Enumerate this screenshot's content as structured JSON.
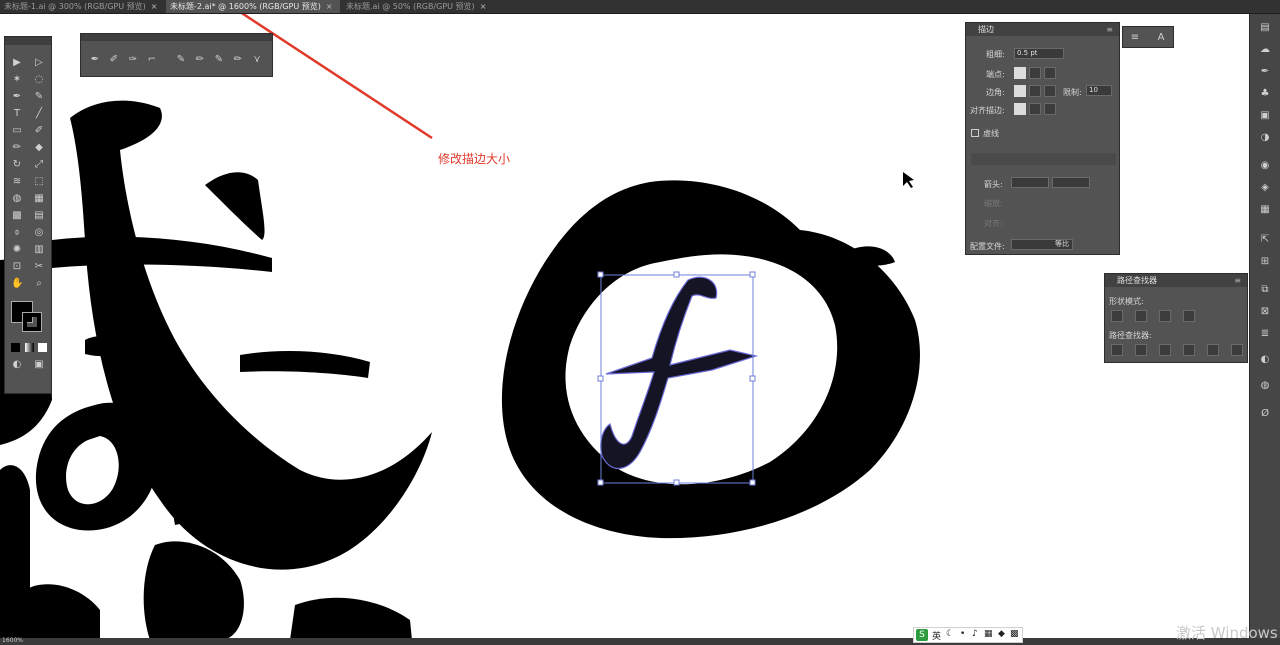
{
  "tabs": [
    {
      "label": "未标题-1.ai @ 300% (RGB/GPU 预览)",
      "close": "×"
    },
    {
      "label": "未标题-2.ai* @ 1600% (RGB/GPU 预览)",
      "close": "×"
    },
    {
      "label": "未标题.ai @ 50% (RGB/GPU 预览)",
      "close": "×"
    }
  ],
  "annotation": {
    "text": "修改描边大小",
    "color": "#e03a2a"
  },
  "stroke_panel": {
    "title": "描边",
    "weight_label": "粗细:",
    "weight_value": "0.5 pt",
    "cap_label": "端点:",
    "corner_label": "边角:",
    "limit_label": "限制:",
    "limit_value": "10",
    "align_label": "对齐描边:",
    "dashed_label": "虚线",
    "arrow_label": "箭头:",
    "scale_label": "缩放:",
    "align2_label": "对齐:",
    "profile_label": "配置文件:",
    "profile_value": "等比"
  },
  "pathfinder_panel": {
    "title": "路径查找器",
    "shape_modes_label": "形状模式:",
    "pathfinders_label": "路径查找器:"
  },
  "status": {
    "zoom": "1600%"
  },
  "ime": {
    "label": "英"
  },
  "watermark": "激活 Windows",
  "icons": {
    "selection": "selection-tool-icon",
    "direct": "direct-selection-icon",
    "pen": "pen-icon",
    "type": "type-tool-icon",
    "hand": "hand-icon",
    "zoom": "zoom-icon"
  }
}
